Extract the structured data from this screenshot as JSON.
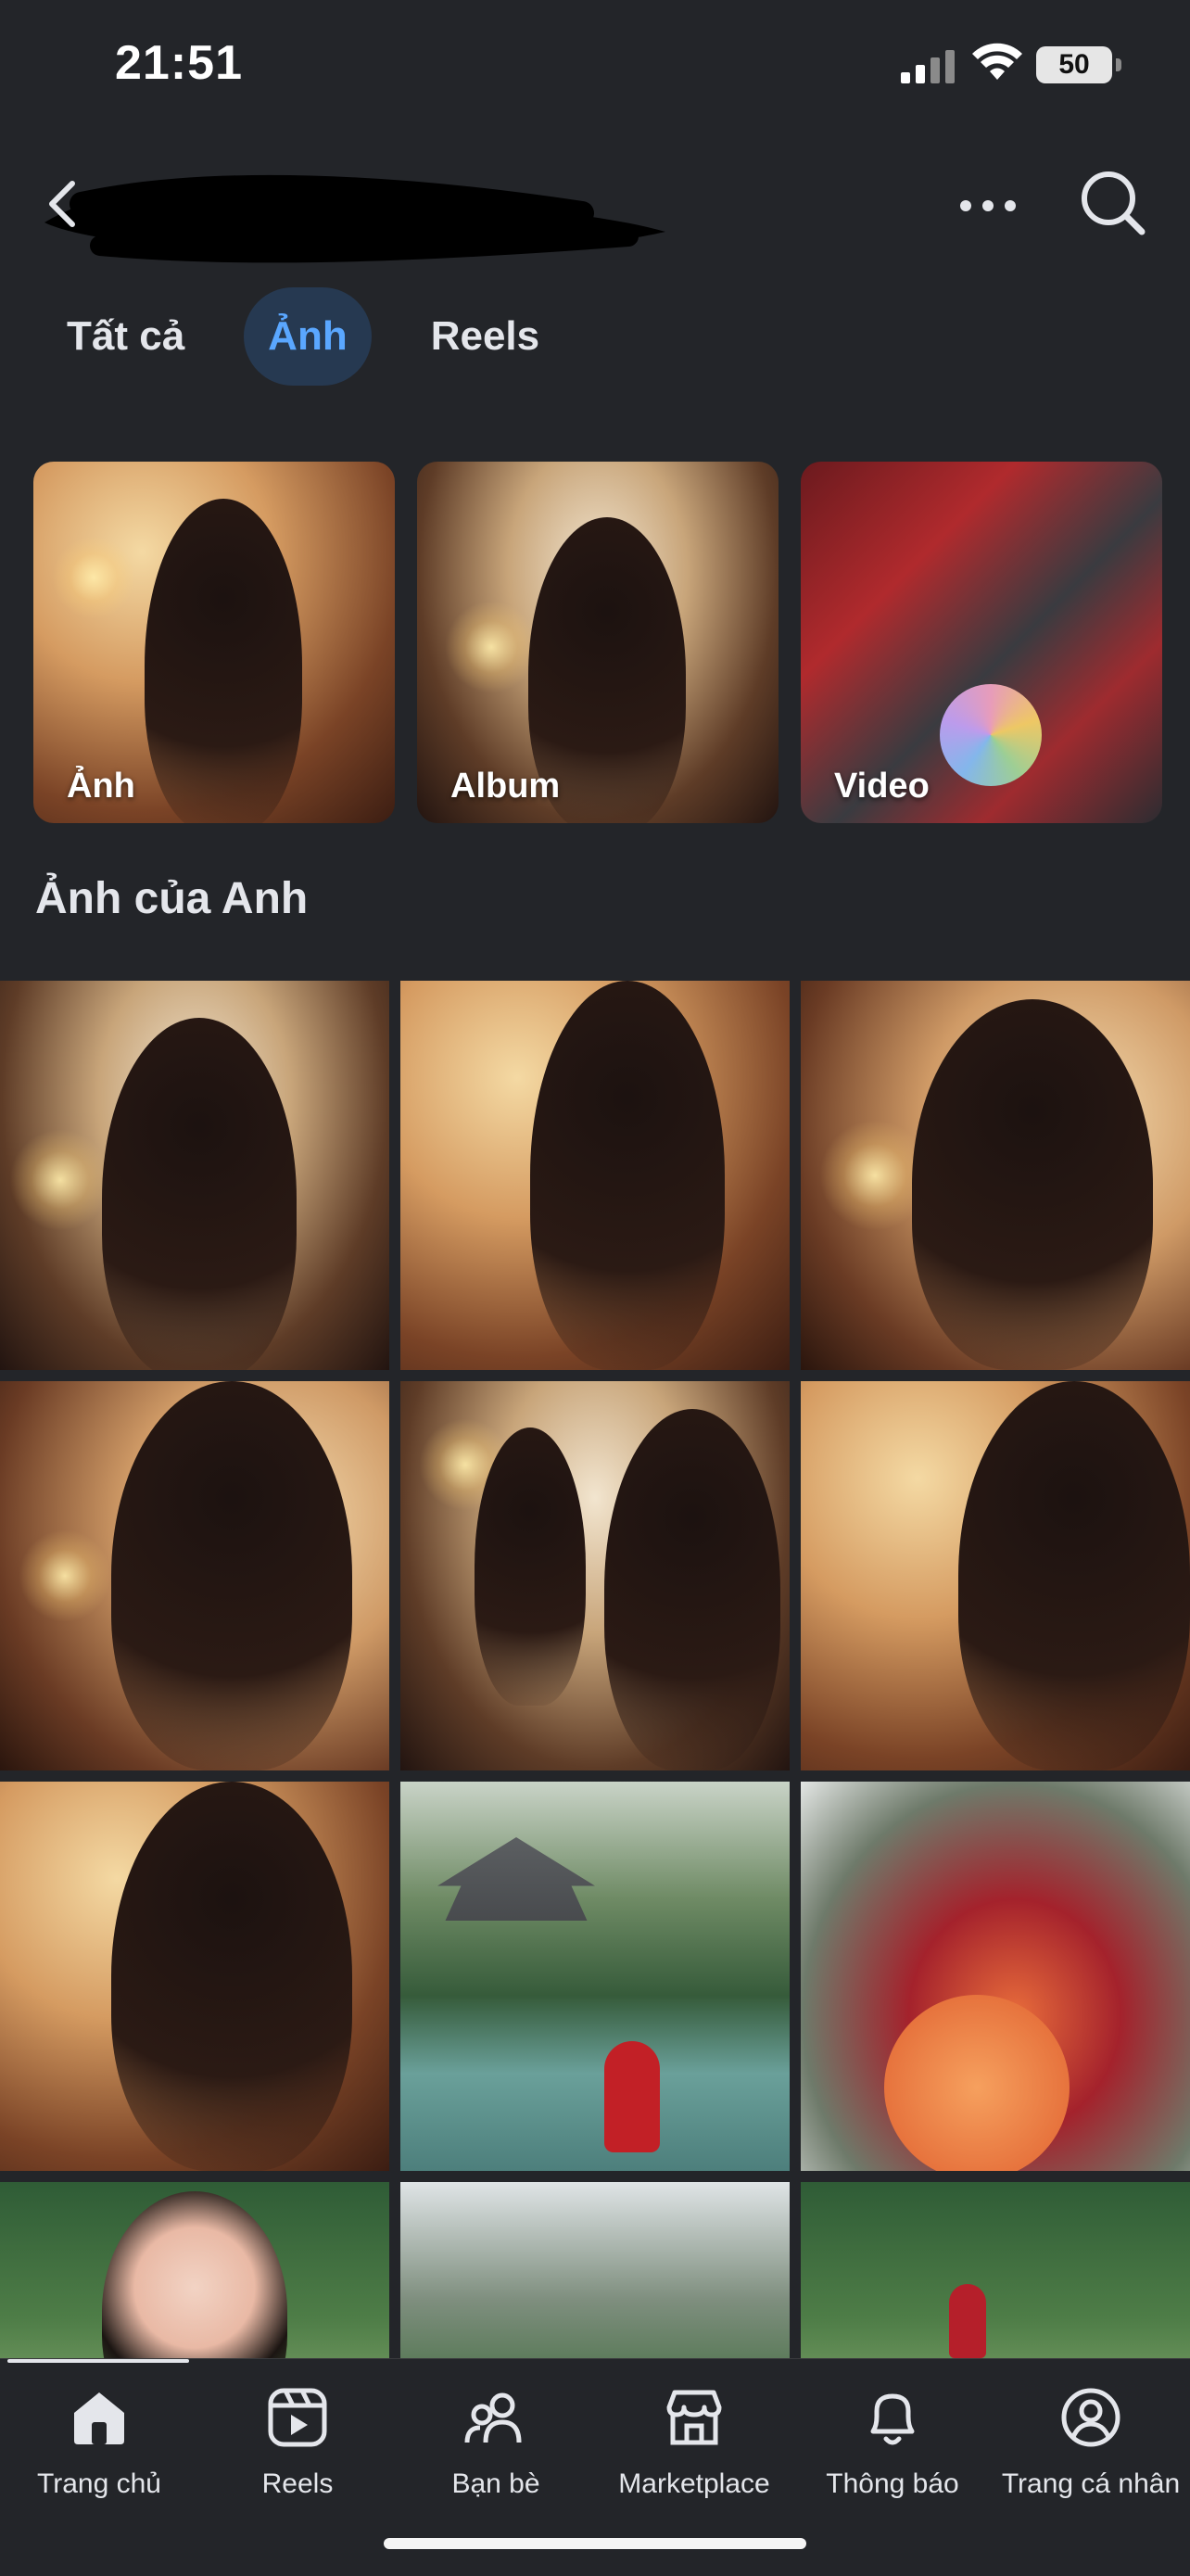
{
  "status_bar": {
    "time": "21:51",
    "battery": "50"
  },
  "header": {
    "back_icon": "back-arrow-icon",
    "more_icon": "more-icon",
    "search_icon": "search-icon"
  },
  "tabs": [
    {
      "label": "Tất cả",
      "active": false
    },
    {
      "label": "Ảnh",
      "active": true
    },
    {
      "label": "Reels",
      "active": false
    }
  ],
  "cards": [
    {
      "label": "Ảnh"
    },
    {
      "label": "Album"
    },
    {
      "label": "Video"
    }
  ],
  "section": {
    "title": "Ảnh của Anh"
  },
  "nav": {
    "items": [
      {
        "label": "Trang chủ",
        "icon": "home-icon",
        "active": true
      },
      {
        "label": "Reels",
        "icon": "reels-icon",
        "active": false
      },
      {
        "label": "Bạn bè",
        "icon": "friends-icon",
        "active": false
      },
      {
        "label": "Marketplace",
        "icon": "marketplace-icon",
        "active": false
      },
      {
        "label": "Thông báo",
        "icon": "bell-icon",
        "active": false
      },
      {
        "label": "Trang cá nhân",
        "icon": "profile-icon",
        "active": false
      }
    ]
  },
  "colors": {
    "background": "#232529",
    "accent": "#5aa7ff",
    "active_tab_bg": "#263951"
  }
}
